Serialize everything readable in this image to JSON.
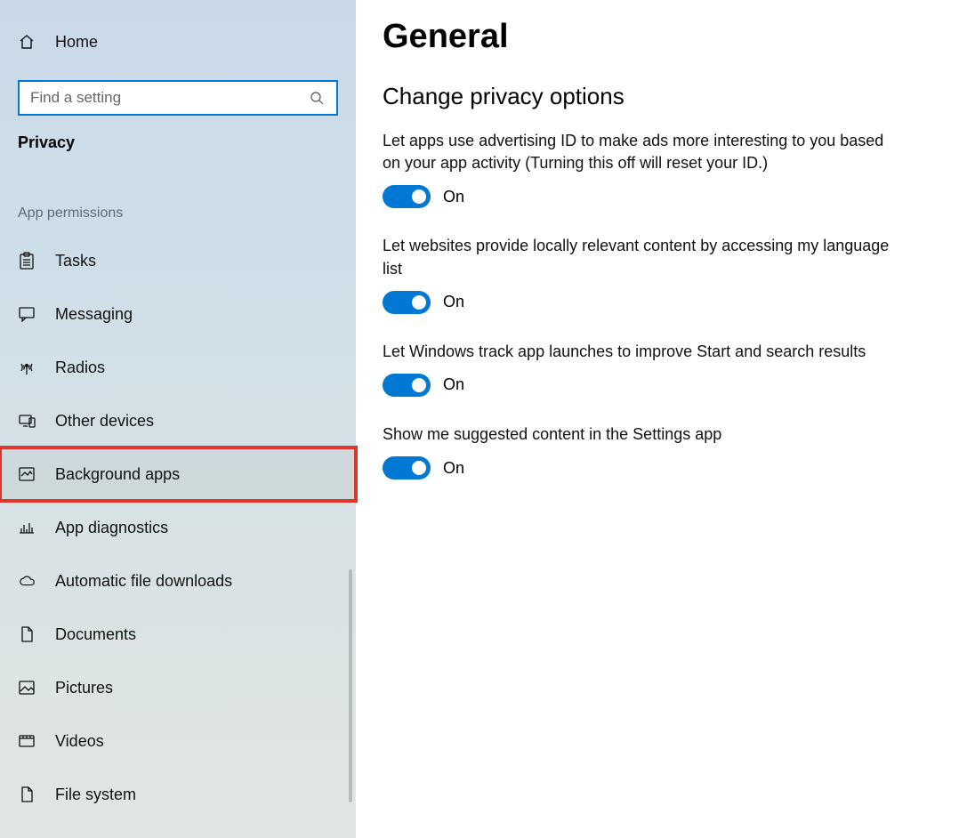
{
  "sidebar": {
    "home_label": "Home",
    "search_placeholder": "Find a setting",
    "category_label": "Privacy",
    "section_heading": "App permissions",
    "items": [
      {
        "label": "Tasks"
      },
      {
        "label": "Messaging"
      },
      {
        "label": "Radios"
      },
      {
        "label": "Other devices"
      },
      {
        "label": "Background apps"
      },
      {
        "label": "App diagnostics"
      },
      {
        "label": "Automatic file downloads"
      },
      {
        "label": "Documents"
      },
      {
        "label": "Pictures"
      },
      {
        "label": "Videos"
      },
      {
        "label": "File system"
      }
    ]
  },
  "main": {
    "title": "General",
    "section_title": "Change privacy options",
    "settings": [
      {
        "desc": "Let apps use advertising ID to make ads more interesting to you based on your app activity (Turning this off will reset your ID.)",
        "state": "On"
      },
      {
        "desc": "Let websites provide locally relevant content by accessing my language list",
        "state": "On"
      },
      {
        "desc": "Let Windows track app launches to improve Start and search results",
        "state": "On"
      },
      {
        "desc": "Show me suggested content in the Settings app",
        "state": "On"
      }
    ]
  }
}
